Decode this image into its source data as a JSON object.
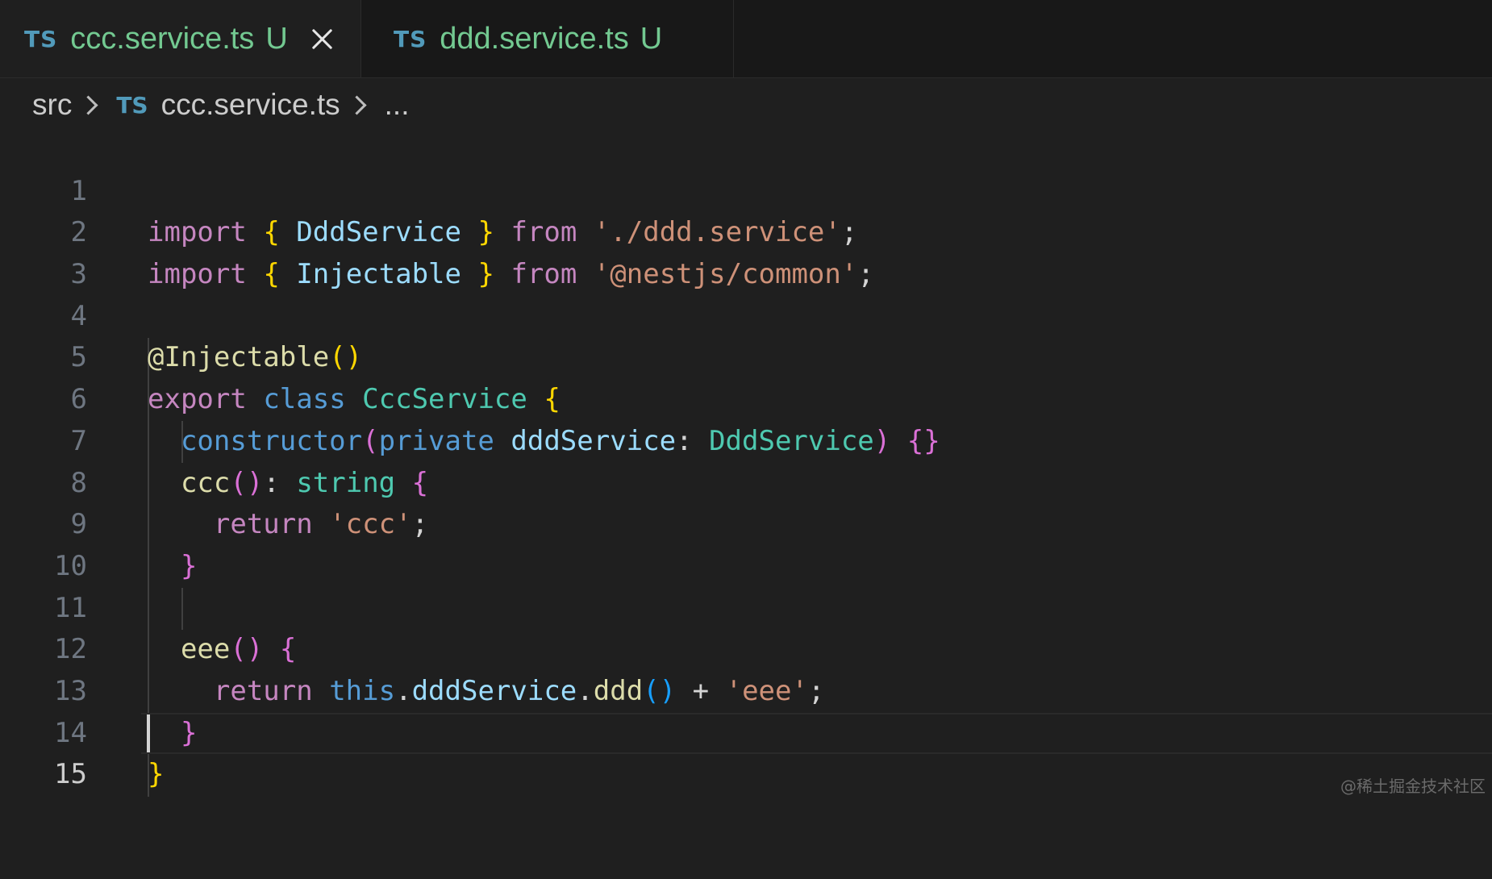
{
  "tabs": [
    {
      "lang_badge": "TS",
      "name": "ccc.service.ts",
      "status": "U",
      "active": true
    },
    {
      "lang_badge": "TS",
      "name": "ddd.service.ts",
      "status": "U",
      "active": false
    }
  ],
  "breadcrumb": {
    "folder": "src",
    "lang_badge": "TS",
    "file": "ccc.service.ts",
    "more": "..."
  },
  "editor": {
    "current_line": 15,
    "lines": [
      {
        "n": "1"
      },
      {
        "n": "2"
      },
      {
        "n": "3"
      },
      {
        "n": "4"
      },
      {
        "n": "5"
      },
      {
        "n": "6"
      },
      {
        "n": "7"
      },
      {
        "n": "8"
      },
      {
        "n": "9"
      },
      {
        "n": "10"
      },
      {
        "n": "11"
      },
      {
        "n": "12"
      },
      {
        "n": "13"
      },
      {
        "n": "14"
      },
      {
        "n": "15"
      }
    ],
    "tokens": {
      "import": "import",
      "from": "from",
      "ob": "{",
      "cb": "}",
      "lp": "(",
      "rp": ")",
      "semi": ";",
      "colon": ":",
      "dot": ".",
      "plus": "+",
      "DddService": "DddService",
      "Injectable": "Injectable",
      "path_ddd": "'./ddd.service'",
      "path_common": "'@nestjs/common'",
      "at": "@",
      "export": "export",
      "class": "class",
      "CccService": "CccService",
      "constructor": "constructor",
      "private": "private",
      "dddService": "dddService",
      "ccc": "ccc",
      "string": "string",
      "return": "return",
      "str_ccc": "'ccc'",
      "eee": "eee",
      "this": "this",
      "ddd": "ddd",
      "str_eee": "'eee'"
    }
  },
  "watermark": "@稀土掘金技术社区"
}
